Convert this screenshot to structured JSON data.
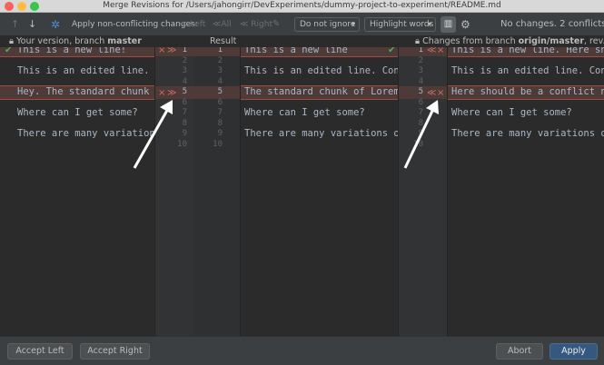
{
  "window": {
    "title": "Merge Revisions for /Users/jahongirr/DevExperiments/dummy-project-to-experiment/README.md"
  },
  "toolbar": {
    "up_icon": "↑",
    "down_icon": "↓",
    "magic_icon": "✲",
    "apply_label": "Apply non-conflicting changes:",
    "left_label": "Left",
    "all_label": "All",
    "right_label": "Right",
    "ignore_value": "Do not ignore",
    "highlight_value": "Highlight words",
    "status": "No changes. 2 conflicts"
  },
  "headers": {
    "left_prefix": "Your version, branch ",
    "left_branch": "master",
    "result": "Result",
    "right_prefix": "Changes from branch ",
    "right_branch": "origin/master",
    "right_suffix": ", rev..."
  },
  "left_lines": [
    "This is a new line!",
    "",
    "This is an edited line. Con",
    "",
    "Hey. The standard chunk of",
    "",
    "Where can I get some?",
    "",
    "There are many variations o"
  ],
  "result_lines": [
    "This is a new line",
    "",
    "This is an edited line. Contra",
    "",
    "The standard chunk of Lorem Ip",
    "",
    "Where can I get some?",
    "",
    "There are many variations of p"
  ],
  "right_lines": [
    "This is a new line. Here sho",
    "",
    "This is an edited line. Contr",
    "",
    "Here should be a conflict num",
    "",
    "Where can I get some?",
    "",
    "There are many variations of"
  ],
  "line_numbers": [
    "1",
    "2",
    "3",
    "4",
    "5",
    "6",
    "7",
    "8",
    "9",
    "10"
  ],
  "markers": {
    "accept": "≫",
    "reject": "×",
    "accept_left": "≪",
    "check": "✔"
  },
  "buttons": {
    "accept_left": "Accept Left",
    "accept_right": "Accept Right",
    "abort": "Abort",
    "apply": "Apply"
  },
  "colors": {
    "conflict": "#4e3a36",
    "accent": "#365880",
    "check": "#59a869"
  }
}
